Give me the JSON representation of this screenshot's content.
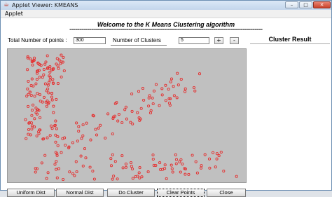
{
  "window": {
    "title": "Applet Viewer: KMEANS",
    "min_glyph": "–",
    "max_glyph": "□",
    "close_glyph": "✕"
  },
  "menu": {
    "applet": "Applet"
  },
  "header": {
    "welcome": "Welcome to the K Means Clustering algorithm",
    "separator": "=================================================================================================="
  },
  "controls": {
    "total_points_label": "Total Number of points :",
    "total_points_value": "300",
    "clusters_label": "Number of Clusters",
    "clusters_value": "5",
    "plus_label": "+",
    "minus_label": "-"
  },
  "result": {
    "label": "Cluster Result"
  },
  "buttons": {
    "uniform": "Uniform Dist",
    "normal": "Normal Dist",
    "do_cluster": "Do Cluster",
    "clear": "Clear Points",
    "close": "Close"
  },
  "colors": {
    "plot_bg": "#c0c0c0",
    "point_stroke": "#e53030"
  }
}
